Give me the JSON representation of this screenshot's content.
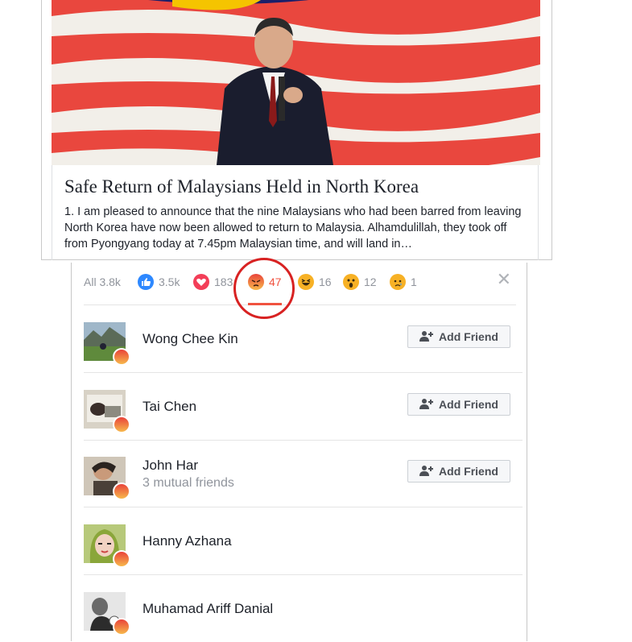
{
  "article": {
    "title": "Safe Return of Malaysians Held in North Korea",
    "description": "1. I am pleased to announce that the nine Malaysians who had been barred from leaving North Korea have now been allowed to return to Malaysia. Alhamdulillah, they took off from Pyongyang today at 7.45pm Malaysian time, and will land in…"
  },
  "reactions": {
    "tabs": [
      {
        "label": "All 3.8k",
        "icon": "none"
      },
      {
        "label": "3.5k",
        "icon": "like-icon",
        "color": "#2d88ff"
      },
      {
        "label": "183",
        "icon": "love-icon",
        "color": "#f33e58"
      },
      {
        "label": "47",
        "icon": "angry-icon",
        "color": "#f0523f",
        "active": true
      },
      {
        "label": "16",
        "icon": "haha-icon",
        "color": "#f7b125"
      },
      {
        "label": "12",
        "icon": "wow-icon",
        "color": "#f7b125"
      },
      {
        "label": "1",
        "icon": "sad-icon",
        "color": "#f7b125"
      }
    ],
    "close_icon": "close-icon"
  },
  "people": [
    {
      "name": "Wong Chee Kin",
      "mutual": "",
      "button": "Add Friend"
    },
    {
      "name": "Tai Chen",
      "mutual": "",
      "button": "Add Friend"
    },
    {
      "name": "John Har",
      "mutual": "3 mutual friends",
      "button": "Add Friend"
    },
    {
      "name": "Hanny Azhana",
      "mutual": "",
      "button": ""
    },
    {
      "name": "Muhamad Ariff Danial",
      "mutual": "",
      "button": ""
    }
  ],
  "colors": {
    "accent_angry": "#f0523f",
    "highlight_circle": "#d82222",
    "text_primary": "#1d2129",
    "text_secondary": "#90949c"
  }
}
